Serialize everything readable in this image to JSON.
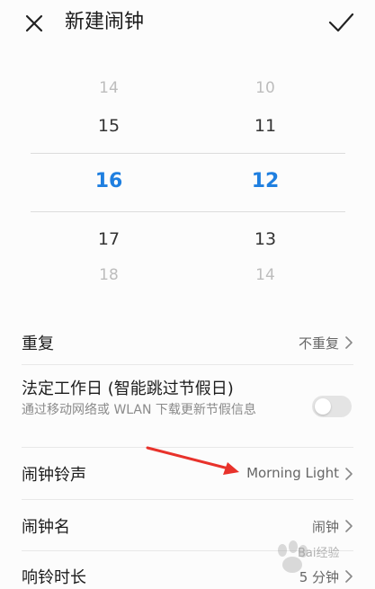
{
  "header": {
    "title": "新建闹钟",
    "close_icon": "close-icon",
    "confirm_icon": "check-icon"
  },
  "picker": {
    "hours": [
      "14",
      "15",
      "16",
      "17",
      "18"
    ],
    "minutes": [
      "10",
      "11",
      "12",
      "13",
      "14"
    ],
    "selected_hour": "16",
    "selected_minute": "12",
    "accent_color": "#1f7fe0"
  },
  "settings": {
    "repeat": {
      "label": "重复",
      "value": "不重复"
    },
    "workday": {
      "label": "法定工作日 (智能跳过节假日)",
      "sub": "通过移动网络或 WLAN 下载更新节假信息",
      "toggle_on": false
    },
    "ringtone": {
      "label": "闹钟铃声",
      "value": "Morning Light"
    },
    "name": {
      "label": "闹钟名",
      "value": "闹钟"
    },
    "duration": {
      "label": "响铃时长",
      "value": "5 分钟"
    }
  },
  "annotation": {
    "arrow_color": "#e8322b"
  },
  "watermark": {
    "text": "Bai经验"
  }
}
